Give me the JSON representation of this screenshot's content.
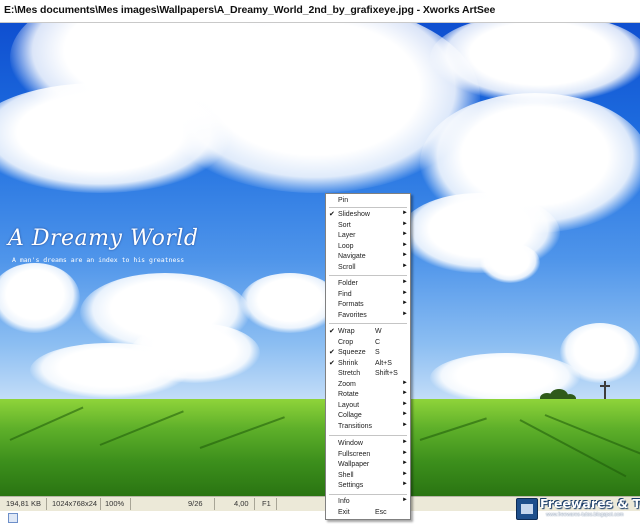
{
  "window": {
    "title": "E:\\Mes documents\\Mes images\\Wallpapers\\A_Dreamy_World_2nd_by_grafixeye.jpg - Xworks ArtSee"
  },
  "wallpaper": {
    "title": "A Dreamy World",
    "subtitle": "A man's dreams are an index to his greatness"
  },
  "status_bar": {
    "file_size": "194,81 KB",
    "dimensions": "1024x768x24",
    "zoom": "100%",
    "position": "9/26",
    "value": "4,00",
    "key": "F1"
  },
  "context_menu": {
    "pin": {
      "label": "Pin"
    },
    "group1": [
      {
        "label": "Slideshow",
        "checked": true,
        "submenu": true
      },
      {
        "label": "Sort",
        "submenu": true
      },
      {
        "label": "Layer",
        "submenu": true
      },
      {
        "label": "Loop",
        "submenu": true
      },
      {
        "label": "Navigate",
        "submenu": true
      },
      {
        "label": "Scroll",
        "submenu": true
      }
    ],
    "group2": [
      {
        "label": "Folder",
        "submenu": true
      },
      {
        "label": "Find",
        "submenu": true
      },
      {
        "label": "Formats",
        "submenu": true
      },
      {
        "label": "Favorites",
        "submenu": true
      }
    ],
    "group3": [
      {
        "label": "Wrap",
        "shortcut": "W",
        "checked": true
      },
      {
        "label": "Crop",
        "shortcut": "C"
      },
      {
        "label": "Squeeze",
        "shortcut": "S",
        "checked": true
      },
      {
        "label": "Shrink",
        "shortcut": "Alt+S",
        "checked": true
      },
      {
        "label": "Stretch",
        "shortcut": "Shift+S"
      },
      {
        "label": "Zoom",
        "submenu": true
      },
      {
        "label": "Rotate",
        "submenu": true
      },
      {
        "label": "Layout",
        "submenu": true
      },
      {
        "label": "Collage",
        "submenu": true
      },
      {
        "label": "Transitions",
        "submenu": true
      }
    ],
    "group4": [
      {
        "label": "Window",
        "submenu": true
      },
      {
        "label": "Fullscreen",
        "submenu": true
      },
      {
        "label": "Wallpaper",
        "submenu": true
      },
      {
        "label": "Shell",
        "submenu": true
      },
      {
        "label": "Settings",
        "submenu": true
      }
    ],
    "group5": [
      {
        "label": "Info",
        "submenu": true
      },
      {
        "label": "Exit",
        "shortcut": "Esc"
      }
    ],
    "check_glyph": "✔",
    "arrow_glyph": "►"
  },
  "watermark": {
    "name": "Freewares & Tutos",
    "url": "www.freewares-tutos.blogspot.com"
  },
  "icons": {
    "menu_check": "check-icon",
    "menu_arrow": "submenu-arrow-icon",
    "logo": "freewares-tutos-logo-icon"
  }
}
